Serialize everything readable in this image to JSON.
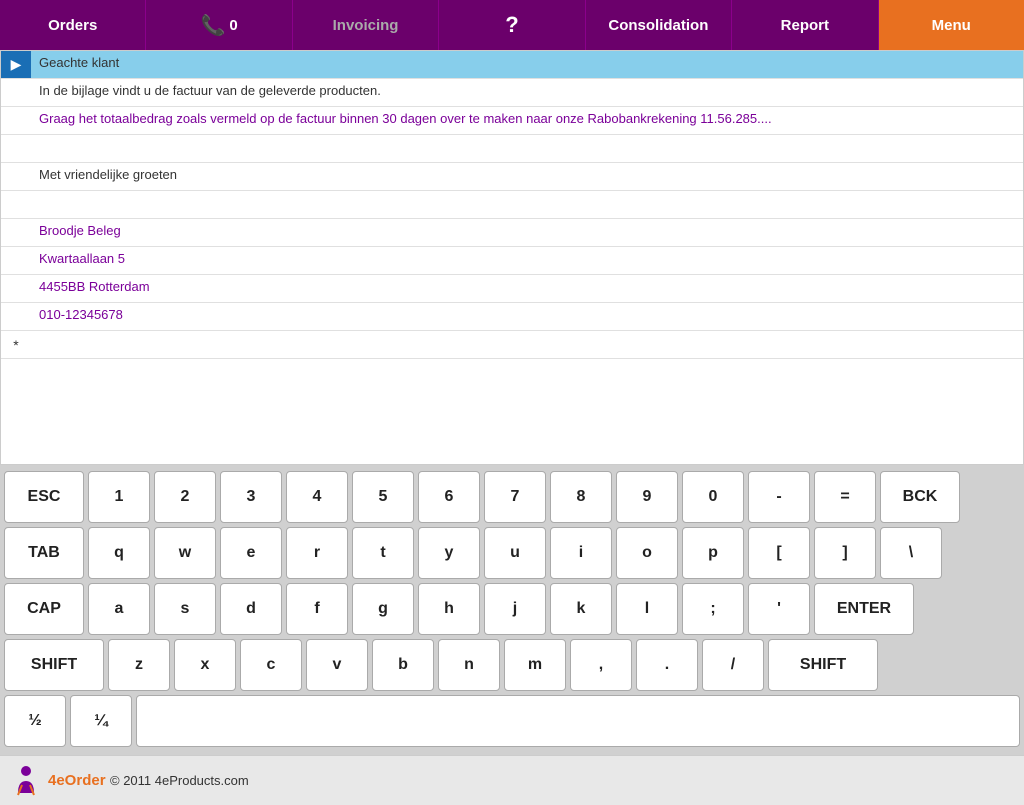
{
  "nav": {
    "items": [
      {
        "id": "orders",
        "label": "Orders",
        "icon": ""
      },
      {
        "id": "phone",
        "label": "0",
        "icon": "📞"
      },
      {
        "id": "invoicing",
        "label": "Invoicing",
        "icon": ""
      },
      {
        "id": "help",
        "label": "?",
        "icon": ""
      },
      {
        "id": "consolidation",
        "label": "Consolidation",
        "icon": ""
      },
      {
        "id": "report",
        "label": "Report",
        "icon": ""
      },
      {
        "id": "menu",
        "label": "Menu",
        "icon": ""
      }
    ]
  },
  "email": {
    "rows": [
      {
        "type": "selected",
        "content": "Geachte klant"
      },
      {
        "type": "normal",
        "content": "In de bijlage vindt u de factuur van de geleverde producten."
      },
      {
        "type": "purple",
        "content": "Graag het totaalbedrag zoals vermeld op de factuur binnen 30 dagen over te maken naar onze Rabobankrekening 11.56.285...."
      },
      {
        "type": "empty",
        "content": ""
      },
      {
        "type": "normal",
        "content": "Met vriendelijke groeten"
      },
      {
        "type": "empty",
        "content": ""
      },
      {
        "type": "purple",
        "content": "Broodje Beleg"
      },
      {
        "type": "purple",
        "content": "Kwartaallaan 5"
      },
      {
        "type": "purple",
        "content": "4455BB Rotterdam"
      },
      {
        "type": "purple",
        "content": "010-12345678"
      }
    ]
  },
  "keyboard": {
    "row1": [
      "ESC",
      "1",
      "2",
      "3",
      "4",
      "5",
      "6",
      "7",
      "8",
      "9",
      "0",
      "-",
      "=",
      "BCK"
    ],
    "row2": [
      "TAB",
      "q",
      "w",
      "e",
      "r",
      "t",
      "y",
      "u",
      "i",
      "o",
      "p",
      "[",
      "]",
      "\\"
    ],
    "row3": [
      "CAP",
      "a",
      "s",
      "d",
      "f",
      "g",
      "h",
      "j",
      "k",
      "l",
      ";",
      "'",
      "ENTER"
    ],
    "row4": [
      "SHIFT",
      "z",
      "x",
      "c",
      "v",
      "b",
      "n",
      "m",
      ",",
      ".",
      "/",
      "SHIFT"
    ],
    "row5_left": [
      "½",
      "¼"
    ],
    "row5_space": " "
  },
  "footer": {
    "copyright": "© 2011 4eProducts.com",
    "brand": "4eOrder"
  }
}
